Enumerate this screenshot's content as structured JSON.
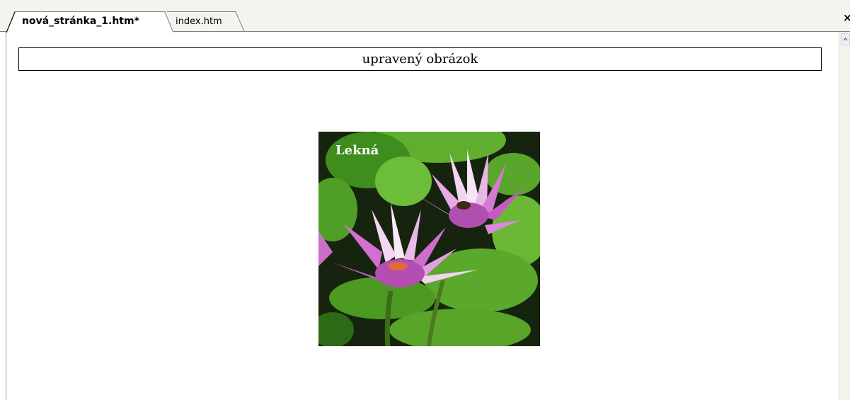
{
  "tabs": [
    {
      "label": "nová_stránka_1.htm*",
      "active": true
    },
    {
      "label": "index.htm",
      "active": false
    }
  ],
  "window": {
    "close_glyph": "×"
  },
  "page": {
    "heading": "upravený obrázok",
    "image": {
      "caption": "Lekná",
      "subject": "water-lily-photo"
    }
  },
  "colors": {
    "tabbar_bg": "#f4f3ee",
    "leaf_green": "#5ea32b",
    "petal_pink": "#d46fc6"
  }
}
